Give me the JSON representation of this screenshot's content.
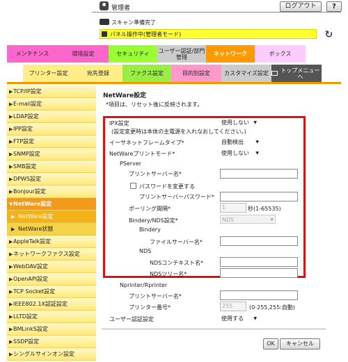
{
  "header": {
    "user_label": "管理者",
    "logout_label": "ログアウト",
    "help_label": "?",
    "scan_status": "スキャン準備完了",
    "panel_status": "パネル操作中(管理者モード)"
  },
  "tabs_row1": [
    {
      "label": "メンテナンス",
      "color": "#ff66cc"
    },
    {
      "label": "環境設定",
      "color": "#ff66cc"
    },
    {
      "label": "セキュリティ",
      "color": "#99ff33"
    },
    {
      "label": "ユーザー認証/部門管理",
      "color": "#cccccc"
    },
    {
      "label": "ネットワーク",
      "color": "#ff9900",
      "active": true
    },
    {
      "label": "ボックス",
      "color": "#ffccff"
    }
  ],
  "tabs_row2": [
    {
      "label": "プリンター設定",
      "color": "#ffee88"
    },
    {
      "label": "宛先登録",
      "color": "#ffee88"
    },
    {
      "label": "ファクス設定",
      "color": "#99ee44"
    },
    {
      "label": "目的別設定",
      "color": "#ff99cc"
    },
    {
      "label": "カスタマイズ設定",
      "color": "#cccccc"
    },
    {
      "label": "トップメニューへ",
      "color": "#555555"
    }
  ],
  "sidebar": {
    "items": [
      {
        "label": "TCP/IP設定"
      },
      {
        "label": "E-mail設定"
      },
      {
        "label": "LDAP設定"
      },
      {
        "label": "IPP設定"
      },
      {
        "label": "FTP設定"
      },
      {
        "label": "SNMP設定"
      },
      {
        "label": "SMB設定"
      },
      {
        "label": "DPWS設定"
      },
      {
        "label": "Bonjour設定"
      },
      {
        "label": "NetWare設定"
      },
      {
        "label": "NetWare設定"
      },
      {
        "label": "NetWare状態"
      },
      {
        "label": "AppleTalk設定"
      },
      {
        "label": "ネットワークファクス設定"
      },
      {
        "label": "WebDAV設定"
      },
      {
        "label": "OpenAPI設定"
      },
      {
        "label": "TCP Socket設定"
      },
      {
        "label": "IEEE802.1X認証設定"
      },
      {
        "label": "LLTD設定"
      },
      {
        "label": "BMLinkS設定"
      },
      {
        "label": "SSDP設定"
      },
      {
        "label": "シングルサインオン設定"
      }
    ]
  },
  "main": {
    "title": "NetWare設定",
    "note": "*項目は、リセット後に反映されます。",
    "ipx_label": "IPX設定",
    "ipx_value": "使用しない",
    "ipx_note": "(設定変更時は本体の主電源を入れなおしてください。)",
    "frame_label": "イーサネットフレームタイプ*",
    "frame_value": "自動検出",
    "print_mode_label": "NetWareプリントモード*",
    "print_mode_value": "使用しない",
    "pserver_label": "PServer",
    "print_server_name_label": "プリントサーバー名*",
    "print_server_name_value": "",
    "change_password_label": "パスワードを変更する",
    "print_server_password_label": "プリントサーバーパスワード*",
    "polling_label": "ポーリング間隔*",
    "polling_value": "1",
    "polling_unit": "秒(1-65535)",
    "bindery_nds_label": "Bindery/NDS設定*",
    "bindery_nds_value": "NDS",
    "bindery_label": "Bindery",
    "file_server_label": "ファイルサーバー名*",
    "nds_label": "NDS",
    "nds_context_label": "NDSコンテキスト名*",
    "nds_tree_label": "NDSツリー名*",
    "nprinter_label": "Nprinter/Rprinter",
    "nprinter_server_label": "プリントサーバー名*",
    "printer_number_label": "プリンター番号*",
    "printer_number_value": "255",
    "printer_number_range": "(0-255,255:自動)",
    "user_auth_label": "ユーザー認証設定",
    "user_auth_value": "使用する",
    "ok_label": "OK",
    "cancel_label": "キャンセル"
  }
}
